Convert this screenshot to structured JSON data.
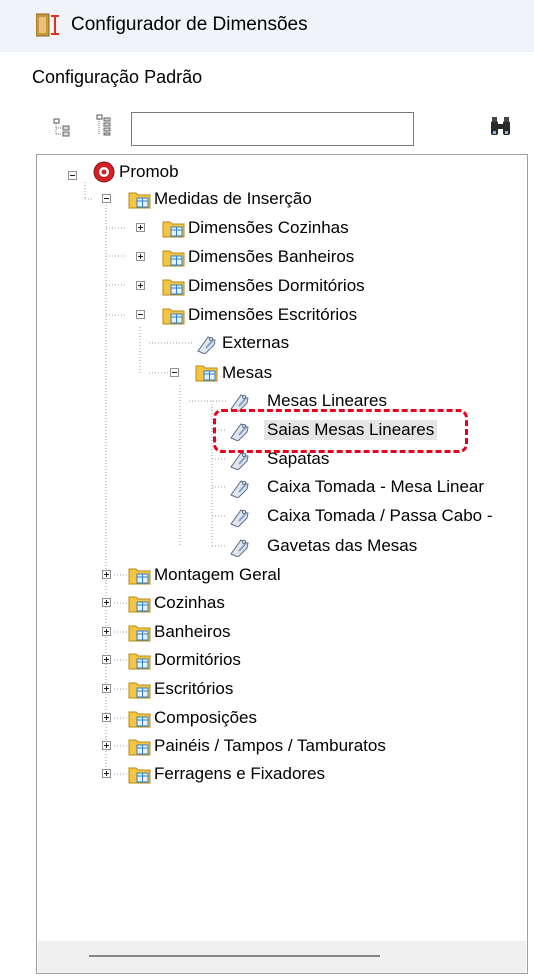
{
  "window": {
    "title": "Configurador de Dimensões"
  },
  "section_label": "Configuração Padrão",
  "search": {
    "value": "",
    "placeholder": ""
  },
  "icons": {
    "app": "configurator-icon",
    "collapse_all": "collapse-tree-icon",
    "expand_all": "expand-tree-icon",
    "find": "binoculars-icon",
    "root": "promob-logo-icon",
    "folder": "folder-icon",
    "item": "tag-icon"
  },
  "tree": {
    "root": "Promob",
    "medidas": "Medidas de Inserção",
    "dim_cozinhas": "Dimensões Cozinhas",
    "dim_banheiros": "Dimensões Banheiros",
    "dim_dormitorios": "Dimensões Dormitórios",
    "dim_escritorios": "Dimensões Escritórios",
    "externas": "Externas",
    "mesas": "Mesas",
    "mesas_lineares": "Mesas Lineares",
    "saias": "Saias Mesas Lineares",
    "sapatas": "Sapatas",
    "caixa_tomada": "Caixa Tomada - Mesa Linear",
    "caixa_passa_cabo": "Caixa Tomada / Passa Cabo -",
    "gavetas": "Gavetas das Mesas",
    "montagem": "Montagem Geral",
    "cozinhas": "Cozinhas",
    "banheiros": "Banheiros",
    "dormitorios": "Dormitórios",
    "escritorios": "Escritórios",
    "composicoes": "Composições",
    "paineis": "Painéis / Tampos / Tamburatos",
    "ferragens": "Ferragens e Fixadores"
  },
  "selected_item": "Saias Mesas Lineares",
  "colors": {
    "highlight_border": "#e8001c",
    "folder": "#f5c542",
    "titlebar_bg": "#f0f4f9"
  }
}
